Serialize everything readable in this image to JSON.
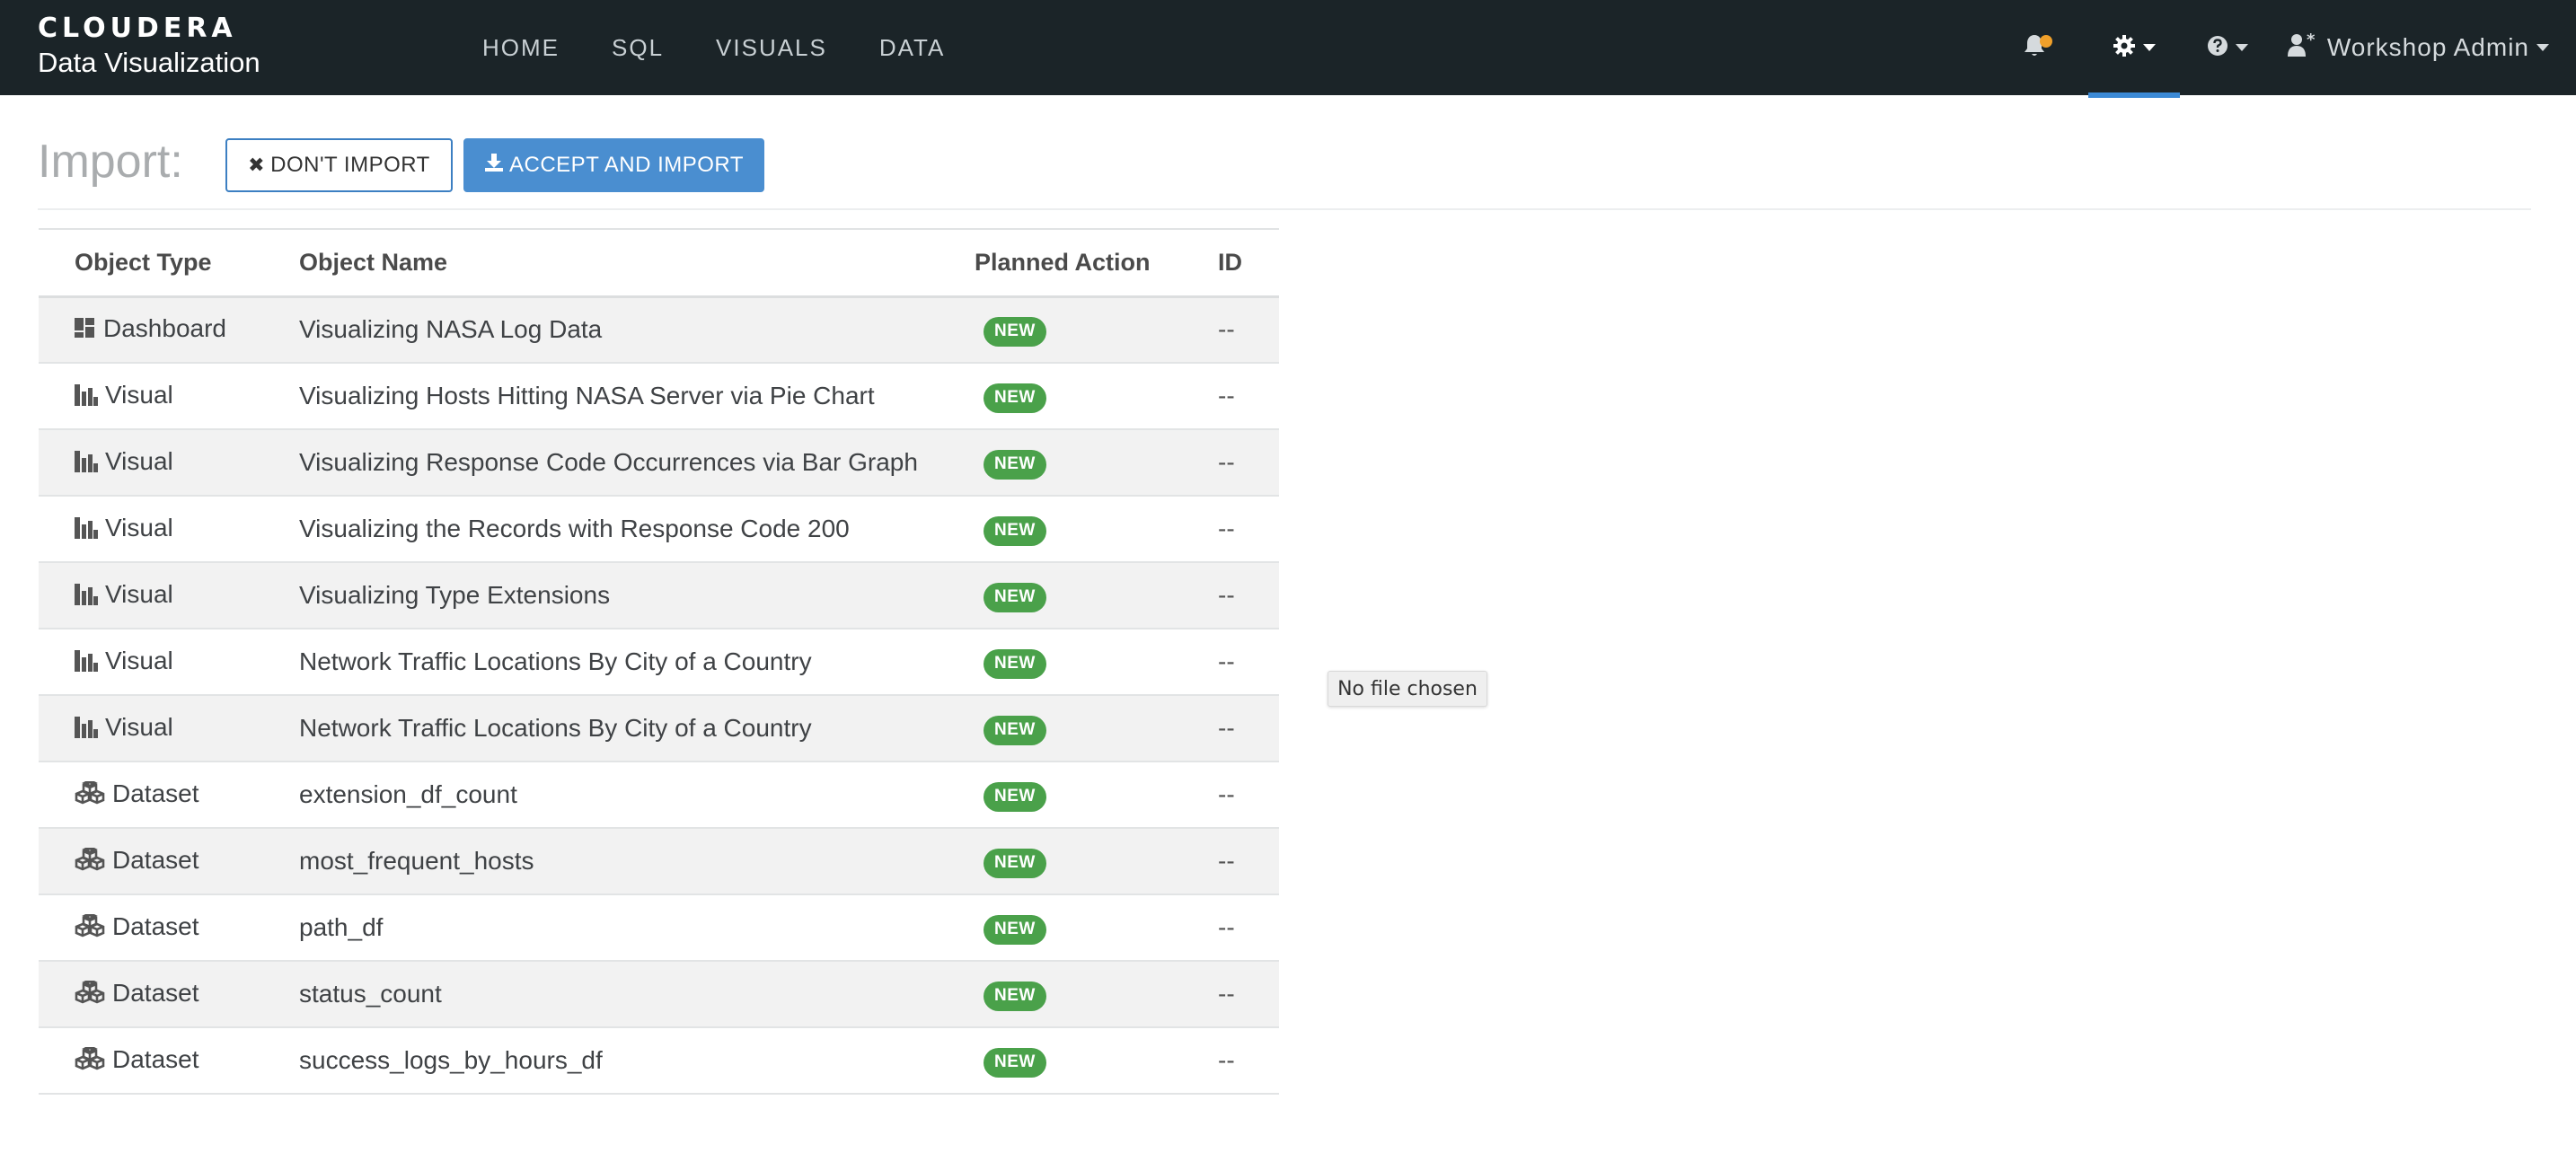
{
  "brand": {
    "company": "CLOUDERA",
    "product": "Data Visualization"
  },
  "nav": {
    "links": [
      "HOME",
      "SQL",
      "VISUALS",
      "DATA"
    ],
    "user": "Workshop Admin"
  },
  "colors": {
    "navbar_bg": "#1b2428",
    "active_tab_accent": "#3c8ad6",
    "notification_dot": "#f0a02a",
    "primary_button": "#4a8ed0",
    "new_badge": "#4aa14a"
  },
  "import": {
    "title": "Import:",
    "dont_import_label": "DON'T IMPORT",
    "accept_label": "ACCEPT AND IMPORT"
  },
  "table": {
    "headers": [
      "Object Type",
      "Object Name",
      "Planned Action",
      "ID"
    ],
    "rows": [
      {
        "type": "Dashboard",
        "icon": "dashboard-icon",
        "name": "Visualizing NASA Log Data",
        "action": "NEW",
        "id": "--"
      },
      {
        "type": "Visual",
        "icon": "bar-chart-icon",
        "name": "Visualizing Hosts Hitting NASA Server via Pie Chart",
        "action": "NEW",
        "id": "--"
      },
      {
        "type": "Visual",
        "icon": "bar-chart-icon",
        "name": "Visualizing Response Code Occurrences via Bar Graph",
        "action": "NEW",
        "id": "--"
      },
      {
        "type": "Visual",
        "icon": "bar-chart-icon",
        "name": "Visualizing the Records with Response Code 200",
        "action": "NEW",
        "id": "--"
      },
      {
        "type": "Visual",
        "icon": "bar-chart-icon",
        "name": "Visualizing Type Extensions",
        "action": "NEW",
        "id": "--"
      },
      {
        "type": "Visual",
        "icon": "bar-chart-icon",
        "name": "Network Traffic Locations By City of a Country",
        "action": "NEW",
        "id": "--"
      },
      {
        "type": "Visual",
        "icon": "bar-chart-icon",
        "name": "Network Traffic Locations By City of a Country",
        "action": "NEW",
        "id": "--"
      },
      {
        "type": "Dataset",
        "icon": "cubes-icon",
        "name": "extension_df_count",
        "action": "NEW",
        "id": "--"
      },
      {
        "type": "Dataset",
        "icon": "cubes-icon",
        "name": "most_frequent_hosts",
        "action": "NEW",
        "id": "--"
      },
      {
        "type": "Dataset",
        "icon": "cubes-icon",
        "name": "path_df",
        "action": "NEW",
        "id": "--"
      },
      {
        "type": "Dataset",
        "icon": "cubes-icon",
        "name": "status_count",
        "action": "NEW",
        "id": "--"
      },
      {
        "type": "Dataset",
        "icon": "cubes-icon",
        "name": "success_logs_by_hours_df",
        "action": "NEW",
        "id": "--"
      }
    ]
  },
  "tooltip": {
    "text": "No file chosen"
  }
}
